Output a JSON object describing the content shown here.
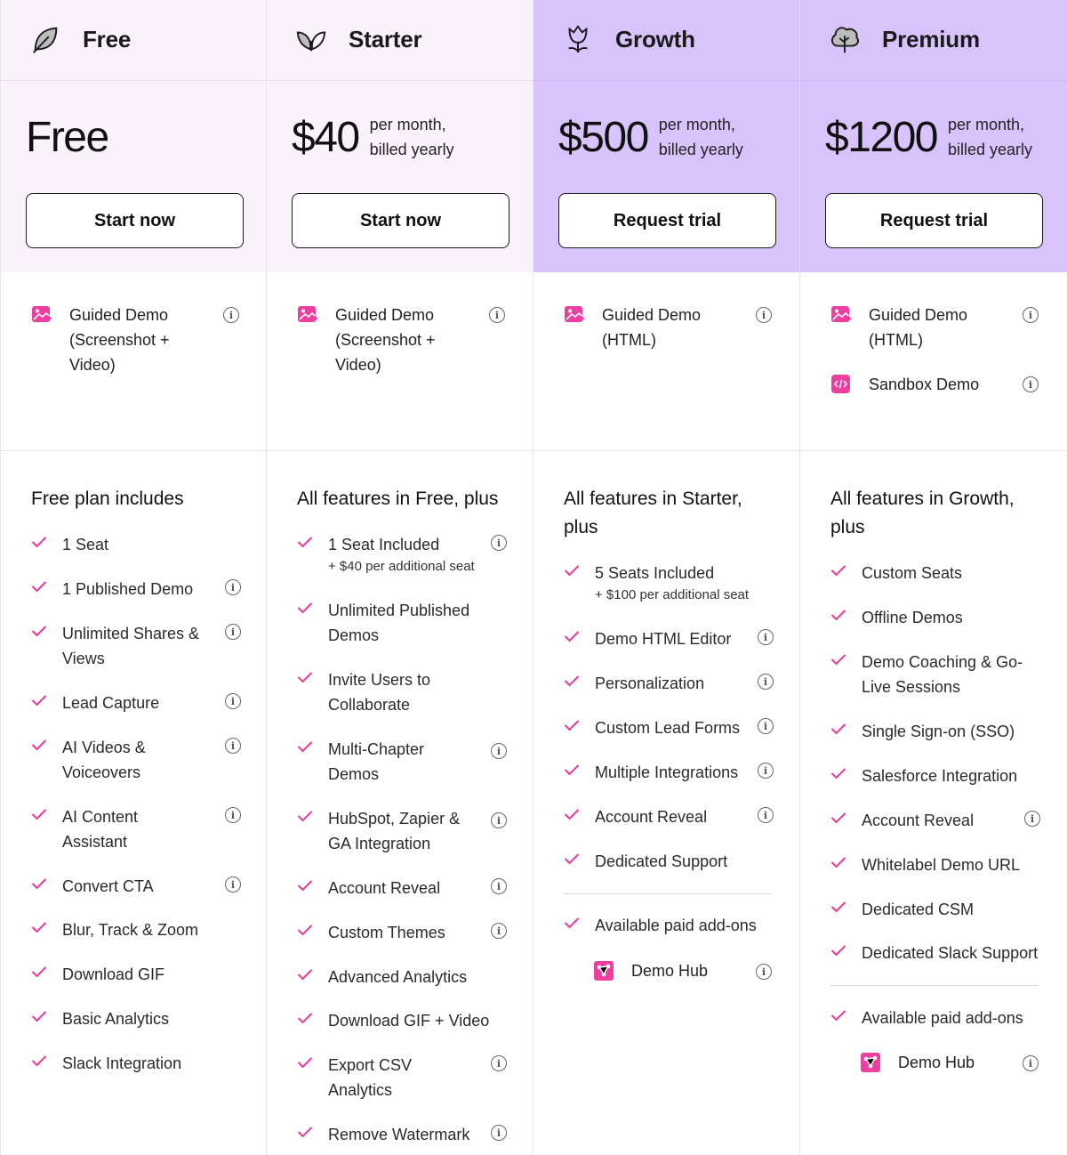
{
  "plans": [
    {
      "name": "Free",
      "icon": "leaf-icon",
      "price": "Free",
      "price_note": "",
      "cta": "Start now",
      "demos": [
        {
          "label": "Guided Demo (Screenshot + Video)",
          "icon": "image-play-icon",
          "info": true
        }
      ],
      "features_heading": "Free plan includes",
      "features": [
        {
          "label": "1 Seat",
          "sub": "",
          "info": false
        },
        {
          "label": "1 Published Demo",
          "sub": "",
          "info": true
        },
        {
          "label": "Unlimited Shares & Views",
          "sub": "",
          "info": true
        },
        {
          "label": "Lead Capture",
          "sub": "",
          "info": true
        },
        {
          "label": "AI Videos & Voiceovers",
          "sub": "",
          "info": true
        },
        {
          "label": "AI Content Assistant",
          "sub": "",
          "info": true
        },
        {
          "label": "Convert CTA",
          "sub": "",
          "info": true
        },
        {
          "label": "Blur, Track & Zoom",
          "sub": "",
          "info": false
        },
        {
          "label": "Download GIF",
          "sub": "",
          "info": false
        },
        {
          "label": "Basic Analytics",
          "sub": "",
          "info": false
        },
        {
          "label": "Slack Integration",
          "sub": "",
          "info": false
        }
      ]
    },
    {
      "name": "Starter",
      "icon": "sprout-icon",
      "price": "$40",
      "price_note": "per month, billed yearly",
      "cta": "Start now",
      "demos": [
        {
          "label": "Guided Demo (Screenshot + Video)",
          "icon": "image-play-icon",
          "info": true
        }
      ],
      "features_heading": "All features in Free, plus",
      "features": [
        {
          "label": "1 Seat Included",
          "sub": "+ $40 per additional seat",
          "info": true
        },
        {
          "label": "Unlimited Published Demos",
          "sub": "",
          "info": false
        },
        {
          "label": "Invite Users to Collaborate",
          "sub": "",
          "info": false
        },
        {
          "label": "Multi-Chapter Demos",
          "sub": "",
          "info": true
        },
        {
          "label": "HubSpot, Zapier & GA Integration",
          "sub": "",
          "info": true
        },
        {
          "label": "Account Reveal",
          "sub": "",
          "info": true
        },
        {
          "label": "Custom Themes",
          "sub": "",
          "info": true
        },
        {
          "label": "Advanced Analytics",
          "sub": "",
          "info": false
        },
        {
          "label": "Download GIF + Video",
          "sub": "",
          "info": false
        },
        {
          "label": "Export CSV Analytics",
          "sub": "",
          "info": true
        },
        {
          "label": "Remove Watermark",
          "sub": "",
          "info": true
        }
      ]
    },
    {
      "name": "Growth",
      "icon": "tulip-icon",
      "price": "$500",
      "price_note": "per month, billed yearly",
      "cta": "Request trial",
      "demos": [
        {
          "label": "Guided Demo (HTML)",
          "icon": "image-play-icon",
          "info": true
        }
      ],
      "features_heading": "All features in Starter, plus",
      "features": [
        {
          "label": "5 Seats Included",
          "sub": "+ $100 per additional seat",
          "info": false
        },
        {
          "label": "Demo HTML Editor",
          "sub": "",
          "info": true
        },
        {
          "label": "Personalization",
          "sub": "",
          "info": true
        },
        {
          "label": "Custom Lead Forms",
          "sub": "",
          "info": true
        },
        {
          "label": "Multiple Integrations",
          "sub": "",
          "info": true
        },
        {
          "label": "Account Reveal",
          "sub": "",
          "info": true
        },
        {
          "label": "Dedicated Support",
          "sub": "",
          "info": false
        }
      ],
      "addons_label": "Available paid add-ons",
      "addons": [
        {
          "label": "Demo Hub",
          "icon": "hub-icon",
          "info": true
        }
      ]
    },
    {
      "name": "Premium",
      "icon": "tree-icon",
      "price": "$1200",
      "price_note": "per month, billed yearly",
      "cta": "Request trial",
      "demos": [
        {
          "label": "Guided Demo (HTML)",
          "icon": "image-play-icon",
          "info": true
        },
        {
          "label": "Sandbox Demo",
          "icon": "code-icon",
          "info": true
        }
      ],
      "features_heading": "All features in Growth, plus",
      "features": [
        {
          "label": "Custom Seats",
          "sub": "",
          "info": false
        },
        {
          "label": "Offline Demos",
          "sub": "",
          "info": false
        },
        {
          "label": "Demo Coaching & Go-Live Sessions",
          "sub": "",
          "info": false
        },
        {
          "label": "Single Sign-on (SSO)",
          "sub": "",
          "info": false
        },
        {
          "label": "Salesforce Integration",
          "sub": "",
          "info": false
        },
        {
          "label": "Account Reveal",
          "sub": "",
          "info": true
        },
        {
          "label": "Whitelabel Demo URL",
          "sub": "",
          "info": false
        },
        {
          "label": "Dedicated CSM",
          "sub": "",
          "info": false
        },
        {
          "label": "Dedicated Slack Support",
          "sub": "",
          "info": false
        }
      ],
      "addons_label": "Available paid add-ons",
      "addons": [
        {
          "label": "Demo Hub",
          "icon": "hub-icon",
          "info": true
        }
      ]
    }
  ],
  "colors": {
    "light_band": "#faf2fb",
    "accent_band": "#d9c3fd",
    "check": "#e5399c",
    "icon_pink": "#ec3fa0"
  }
}
